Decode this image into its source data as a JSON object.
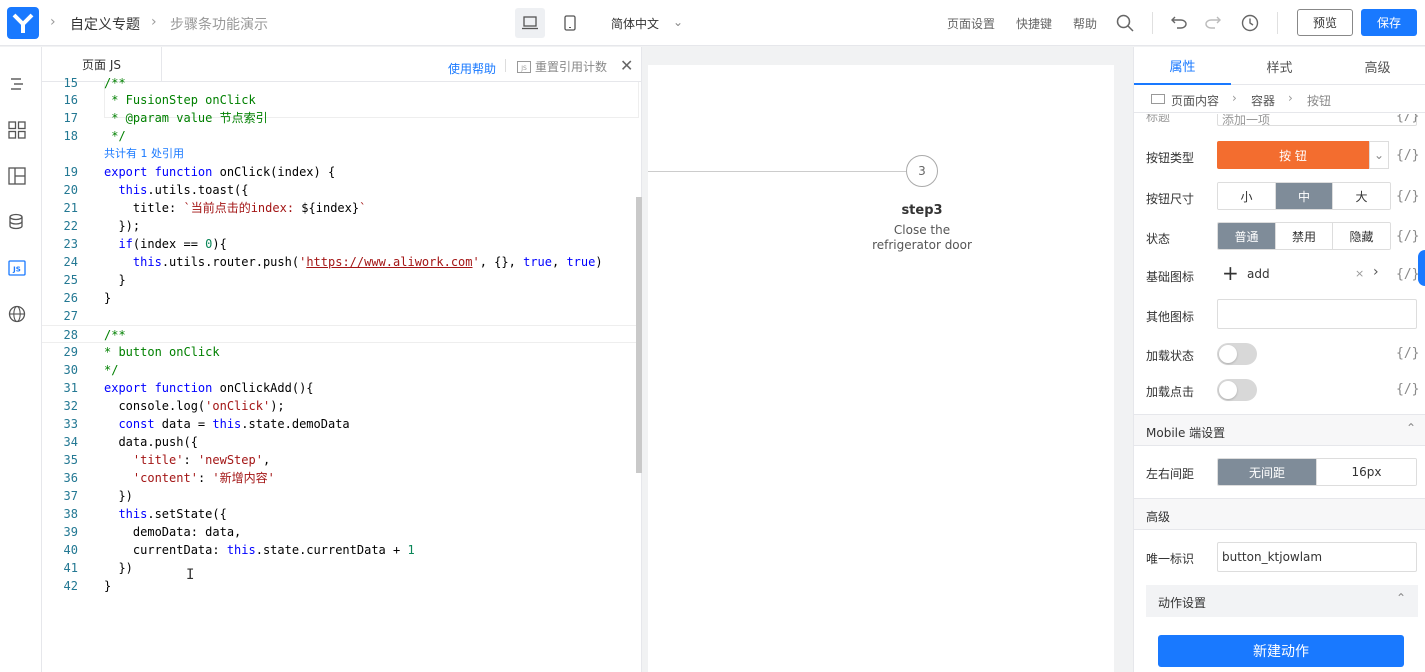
{
  "header": {
    "breadcrumb": [
      "自定义专题",
      "步骤条功能演示"
    ],
    "language": "简体中文",
    "menu": [
      "页面设置",
      "快捷键",
      "帮助"
    ],
    "preview_label": "预览",
    "save_label": "保存",
    "colors": {
      "accent": "#1979ff",
      "logo": "#1979ff"
    }
  },
  "sidebar": {
    "icons": [
      "outline-icon",
      "components-icon",
      "layout-icon",
      "datasource-icon",
      "js-icon",
      "globe-icon"
    ]
  },
  "editor": {
    "tab_label": "页面 JS",
    "help_label": "使用帮助",
    "reset_label": "重置引用计数",
    "ref_hint": "共计有 1 处引用",
    "lines": [
      {
        "n": "15",
        "t": "/**"
      },
      {
        "n": "16",
        "t": " * FusionStep onClick"
      },
      {
        "n": "17",
        "t": " * @param value 节点索引"
      },
      {
        "n": "18",
        "t": " */"
      },
      {
        "n": "19",
        "t": "export function onClick(index) {"
      },
      {
        "n": "20",
        "t": "  this.utils.toast({"
      },
      {
        "n": "21",
        "t": "    title: `当前点击的index: ${index}`"
      },
      {
        "n": "22",
        "t": "  });"
      },
      {
        "n": "23",
        "t": "  if(index == 0){"
      },
      {
        "n": "24",
        "t": "    this.utils.router.push('https://www.aliwork.com', {}, true, true)"
      },
      {
        "n": "25",
        "t": "  }"
      },
      {
        "n": "26",
        "t": "}"
      },
      {
        "n": "27",
        "t": ""
      },
      {
        "n": "28",
        "t": "/**"
      },
      {
        "n": "29",
        "t": "* button onClick"
      },
      {
        "n": "30",
        "t": "*/"
      },
      {
        "n": "31",
        "t": "export function onClickAdd(){"
      },
      {
        "n": "32",
        "t": "  console.log('onClick');"
      },
      {
        "n": "33",
        "t": "  const data = this.state.demoData"
      },
      {
        "n": "34",
        "t": "  data.push({"
      },
      {
        "n": "35",
        "t": "    'title': 'newStep',"
      },
      {
        "n": "36",
        "t": "    'content': '新增内容'"
      },
      {
        "n": "37",
        "t": "  })"
      },
      {
        "n": "38",
        "t": "  this.setState({"
      },
      {
        "n": "39",
        "t": "    demoData: data,"
      },
      {
        "n": "40",
        "t": "    currentData: this.state.currentData + 1"
      },
      {
        "n": "41",
        "t": "  })"
      },
      {
        "n": "42",
        "t": "}"
      }
    ]
  },
  "canvas": {
    "step_number": "3",
    "step_title": "step3",
    "step_desc": "Close the refrigerator door"
  },
  "props": {
    "tabs": [
      "属性",
      "样式",
      "高级"
    ],
    "breadcrumb": [
      "页面内容",
      "容器",
      "按钮"
    ],
    "fields": {
      "title_label": "标题",
      "title_value": "添加一项",
      "btn_type_label": "按钮类型",
      "btn_type_value": "按 钮",
      "btn_type_color": "#f36d2f",
      "btn_size_label": "按钮尺寸",
      "btn_size_options": [
        "小",
        "中",
        "大"
      ],
      "state_label": "状态",
      "state_options": [
        "普通",
        "禁用",
        "隐藏"
      ],
      "base_icon_label": "基础图标",
      "base_icon_value": "add",
      "other_icon_label": "其他图标",
      "loading_label": "加载状态",
      "loading_click_label": "加载点击",
      "fx_label": "{/}"
    },
    "mobile_section": "Mobile 端设置",
    "margin_label": "左右间距",
    "margin_options": [
      "无间距",
      "16px"
    ],
    "advanced_section": "高级",
    "id_label": "唯一标识",
    "id_value": "button_ktjowlam",
    "action_section": "动作设置",
    "new_action_label": "新建动作"
  }
}
